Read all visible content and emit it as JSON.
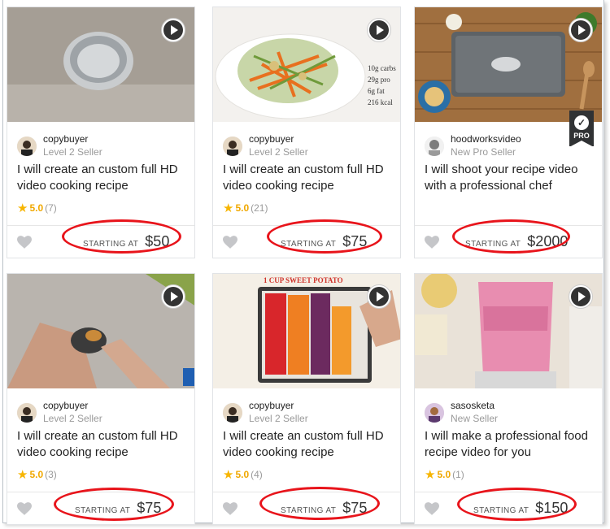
{
  "gigs": [
    {
      "seller": "copybuyer",
      "level": "Level 2 Seller",
      "title": "I will create an custom full HD video cooking recipe",
      "rating": "5.0",
      "count": "(7)",
      "price_label": "STARTING AT",
      "price": "$50"
    },
    {
      "seller": "copybuyer",
      "level": "Level 2 Seller",
      "title": "I will create an custom full HD video cooking recipe",
      "rating": "5.0",
      "count": "(21)",
      "price_label": "STARTING AT",
      "price": "$75",
      "thumb_text": [
        "10g carbs",
        "29g pro",
        "6g fat",
        "216 kcal"
      ]
    },
    {
      "seller": "hoodworksvideo",
      "level": "New Pro Seller",
      "title": "I will shoot your recipe video with a professional chef",
      "price_label": "STARTING AT",
      "price": "$2000",
      "badge": "PRO"
    },
    {
      "seller": "copybuyer",
      "level": "Level 2 Seller",
      "title": "I will create an custom full HD video cooking recipe",
      "rating": "5.0",
      "count": "(3)",
      "price_label": "STARTING AT",
      "price": "$75"
    },
    {
      "seller": "copybuyer",
      "level": "Level 2 Seller",
      "title": "I will create an custom full HD video cooking recipe",
      "rating": "5.0",
      "count": "(4)",
      "price_label": "STARTING AT",
      "price": "$75",
      "thumb_text": [
        "1 CUP SWEET POTATO"
      ]
    },
    {
      "seller": "sasosketa",
      "level": "New Seller",
      "title": "I will make a professional food recipe video for you",
      "rating": "5.0",
      "count": "(1)",
      "price_label": "STARTING AT",
      "price": "$150"
    }
  ],
  "colors": {
    "star": "#f7b500",
    "highlight_oval": "#e8141b"
  }
}
